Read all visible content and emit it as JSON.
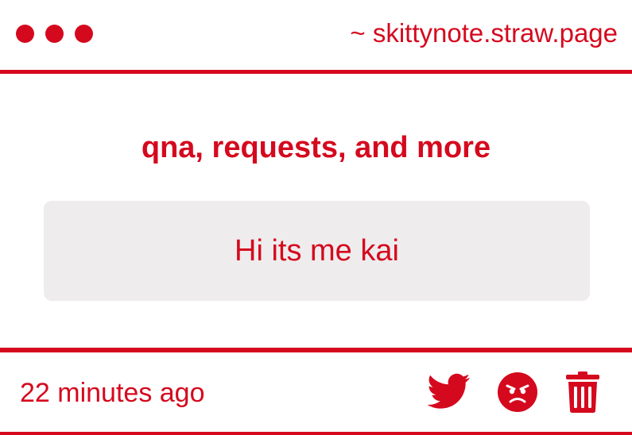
{
  "colors": {
    "accent": "#d5091e",
    "message_background": "#eeeced",
    "background": "#ffffff"
  },
  "window": {
    "dots": [
      "dot",
      "dot",
      "dot"
    ],
    "url": "~ skittynote.straw.page"
  },
  "main": {
    "title": "qna, requests, and more",
    "message": "Hi its me kai"
  },
  "footer": {
    "timestamp": "22 minutes ago",
    "actions": {
      "share_icon": "twitter-icon",
      "react_icon": "angry-face-icon",
      "delete_icon": "trash-icon"
    }
  }
}
